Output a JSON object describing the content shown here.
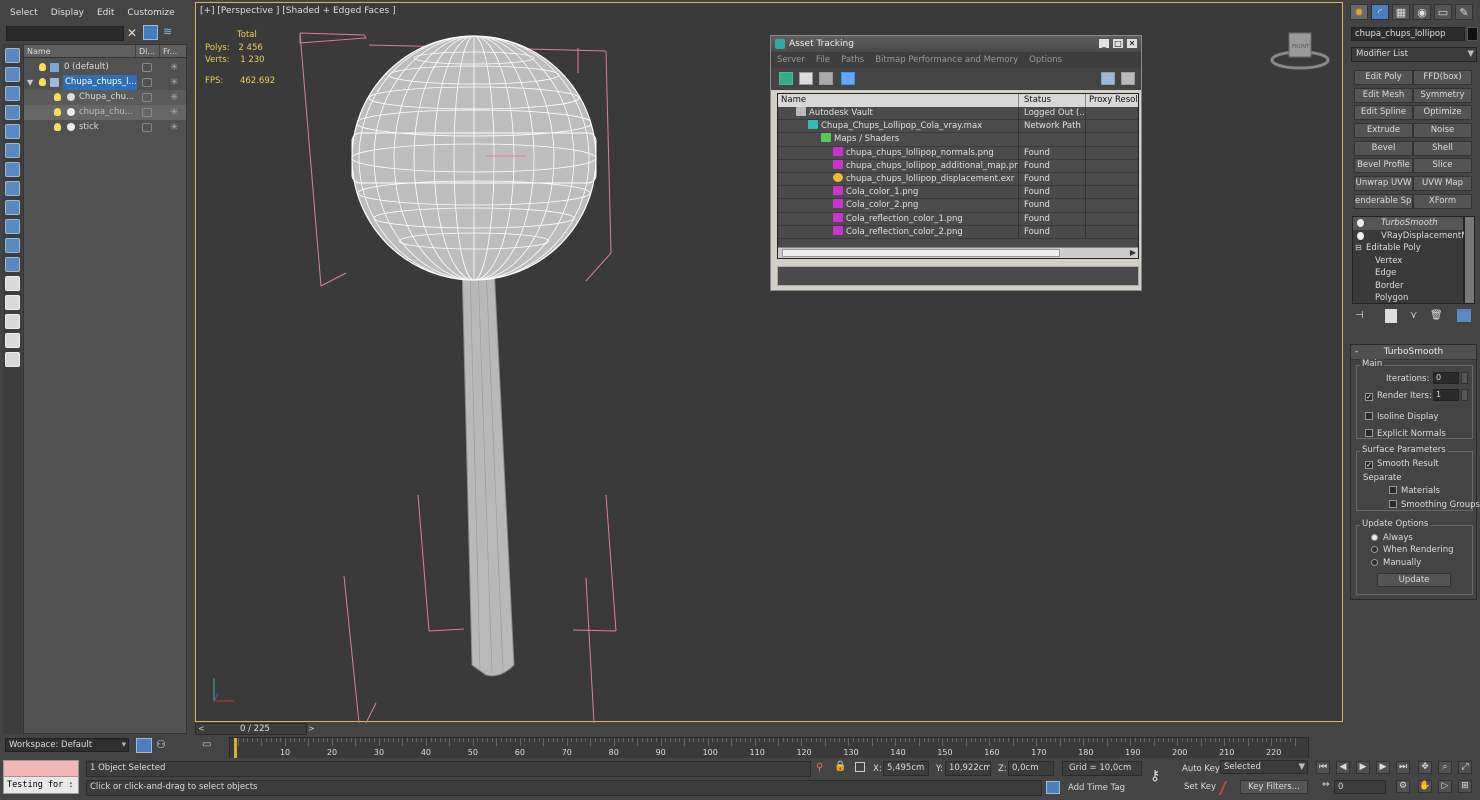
{
  "scene_explorer": {
    "menu": [
      "Select",
      "Display",
      "Edit",
      "Customize"
    ],
    "columns": [
      "Name",
      "Di...",
      "Fr..."
    ],
    "rows": [
      {
        "label": "0 (default)",
        "indent": 0,
        "selected": false
      },
      {
        "label": "Chupa_chups_l...",
        "indent": 0,
        "selected": true
      },
      {
        "label": "Chupa_chu...",
        "indent": 1,
        "selected": false
      },
      {
        "label": "chupa_chu...",
        "indent": 1,
        "selected": false
      },
      {
        "label": "stick",
        "indent": 1,
        "selected": false
      }
    ],
    "workspace": "Workspace: Default"
  },
  "viewport": {
    "label": "[+] [Perspective ] [Shaded + Edged Faces ]",
    "stats": {
      "total_label": "Total",
      "polys_label": "Polys:",
      "polys_value": "2 456",
      "verts_label": "Verts:",
      "verts_value": "1 230",
      "fps_label": "FPS:",
      "fps_value": "462.692"
    },
    "viewcube_label": "FRONT"
  },
  "asset_tracking": {
    "title": "Asset Tracking",
    "menu": [
      "Server",
      "File",
      "Paths",
      "Bitmap Performance and Memory",
      "Options"
    ],
    "columns": [
      "Name",
      "Status",
      "Proxy Resolu"
    ],
    "rows": [
      {
        "name": "Autodesk Vault",
        "status": "Logged Out (...",
        "icon": "vault",
        "level": 0
      },
      {
        "name": "Chupa_Chups_Lollipop_Cola_vray.max",
        "status": "Network Path",
        "icon": "max",
        "level": 1
      },
      {
        "name": "Maps / Shaders",
        "status": "",
        "icon": "maps",
        "level": 2
      },
      {
        "name": "chupa_chups_lollipop_normals.png",
        "status": "Found",
        "icon": "png",
        "level": 3
      },
      {
        "name": "chupa_chups_lollipop_additional_map.png",
        "status": "Found",
        "icon": "png",
        "level": 3
      },
      {
        "name": "chupa_chups_lollipop_displacement.exr",
        "status": "Found",
        "icon": "exr",
        "level": 3
      },
      {
        "name": "Cola_color_1.png",
        "status": "Found",
        "icon": "png",
        "level": 3
      },
      {
        "name": "Cola_color_2.png",
        "status": "Found",
        "icon": "png",
        "level": 3
      },
      {
        "name": "Cola_reflection_color_1.png",
        "status": "Found",
        "icon": "png",
        "level": 3
      },
      {
        "name": "Cola_reflection_color_2.png",
        "status": "Found",
        "icon": "png",
        "level": 3
      }
    ]
  },
  "command_panel": {
    "object_name": "chupa_chups_lollipop",
    "modifier_list": "Modifier List",
    "modifier_buttons": [
      "Edit Poly",
      "FFD(box)",
      "Edit Mesh",
      "Symmetry",
      "Edit Spline",
      "Optimize",
      "Extrude",
      "Noise",
      "Bevel",
      "Shell",
      "Bevel Profile",
      "Slice",
      "Unwrap UVW",
      "UVW Map",
      "enderable Splir",
      "XForm"
    ],
    "stack": [
      {
        "label": "TurboSmooth",
        "italic": true
      },
      {
        "label": "VRayDisplacementMo",
        "italic": false
      },
      {
        "label": "Editable Poly",
        "italic": false
      },
      {
        "label": "Vertex",
        "italic": false
      },
      {
        "label": "Edge",
        "italic": false
      },
      {
        "label": "Border",
        "italic": false
      },
      {
        "label": "Polygon",
        "italic": false
      }
    ],
    "turbosmooth": {
      "title": "TurboSmooth",
      "main": "Main",
      "iterations_label": "Iterations:",
      "iterations_value": "0",
      "render_iters_label": "Render Iters:",
      "render_iters_value": "1",
      "render_iters_checked": true,
      "isoline_label": "Isoline Display",
      "explicit_label": "Explicit Normals",
      "surface_label": "Surface Parameters",
      "smooth_result_label": "Smooth Result",
      "separate_label": "Separate",
      "materials_label": "Materials",
      "smoothing_label": "Smoothing Groups",
      "update_options_label": "Update Options",
      "always_label": "Always",
      "when_rendering_label": "When Rendering",
      "manually_label": "Manually",
      "update_button": "Update"
    }
  },
  "timeline": {
    "slider": "0 / 225",
    "ticks": [
      "10",
      "20",
      "30",
      "40",
      "50",
      "60",
      "70",
      "80",
      "90",
      "100",
      "110",
      "120",
      "130",
      "140",
      "150",
      "160",
      "170",
      "180",
      "190",
      "200",
      "210",
      "220"
    ]
  },
  "status_bar": {
    "maxscript": "Testing for :",
    "selection": "1 Object Selected",
    "prompt": "Click or click-and-drag to select objects",
    "x_label": "X:",
    "x_value": "5,495cm",
    "y_label": "Y:",
    "y_value": "10,922cm",
    "z_label": "Z:",
    "z_value": "0,0cm",
    "grid": "Grid = 10,0cm",
    "add_time_tag": "Add Time Tag",
    "auto_key": "Auto Key",
    "set_key": "Set Key",
    "selected": "Selected",
    "key_filters": "Key Filters...",
    "frame": "0"
  }
}
